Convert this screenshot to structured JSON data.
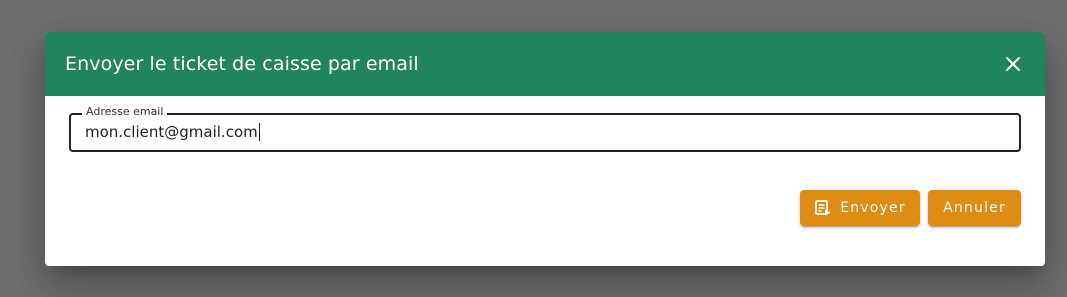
{
  "dialog": {
    "title": "Envoyer le ticket de caisse par email",
    "close_icon": "close-icon",
    "header_color": "#20845c"
  },
  "email_field": {
    "label": "Adresse email",
    "value": "mon.client@gmail.com"
  },
  "actions": {
    "send_label": "Envoyer",
    "send_icon": "send-receipt-icon",
    "cancel_label": "Annuler",
    "button_color": "#df8c14"
  }
}
